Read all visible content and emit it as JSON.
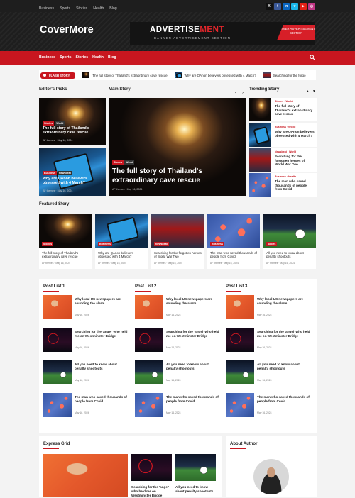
{
  "topbar": {
    "links": [
      "Business",
      "Sports",
      "Stories",
      "Health",
      "Blog"
    ],
    "social": [
      {
        "icon": "x-icon",
        "glyph": "X",
        "color": "#111111"
      },
      {
        "icon": "facebook-icon",
        "glyph": "f",
        "color": "#3b5998"
      },
      {
        "icon": "linkedin-icon",
        "glyph": "in",
        "color": "#0a66c2"
      },
      {
        "icon": "vimeo-icon",
        "glyph": "v",
        "color": "#1ab7ea"
      },
      {
        "icon": "youtube-icon",
        "glyph": "▶",
        "color": "#e62117"
      },
      {
        "icon": "instagram-icon",
        "glyph": "◎",
        "color": "#c13584"
      }
    ]
  },
  "site": {
    "logo": "CoverMore"
  },
  "ad": {
    "word1": "ADVERTISE",
    "word2": "MENT",
    "sub": "BANNER ADVERTISEMENT SECTION",
    "tag": "BANNER ADVERTISEMENT SECTION"
  },
  "nav": {
    "items": [
      "Business",
      "Sports",
      "Stories",
      "Health",
      "Blog"
    ]
  },
  "flash": {
    "label": "FLASH STORY",
    "items": [
      "The full story of Thailand's extraordinary cave rescue",
      "Why are QAnon believers obsessed with 4 March?",
      "Searching for the forgo"
    ]
  },
  "sections": {
    "editors": "Editor's Picks",
    "main": "Main Story",
    "trending": "Trending Story",
    "featured": "Featured Story",
    "pl1": "Post List 1",
    "pl2": "Post List 2",
    "pl3": "Post List 3",
    "express": "Express Grid",
    "about": "About Author"
  },
  "editors": [
    {
      "tags": [
        "Stories",
        "World"
      ],
      "title": "The full story of Thailand's extraordinary cave rescue",
      "author": "AF themes",
      "date": "May 16, 2024"
    },
    {
      "tags": [
        "Business",
        "Newsbeat"
      ],
      "title": "Why are QAnon believers obsessed with 4 March?",
      "author": "AF themes",
      "date": "May 16, 2024"
    }
  ],
  "main": {
    "tags": [
      "Stories",
      "World"
    ],
    "title": "The full story of Thailand's extraordinary cave rescue",
    "author": "AF themes",
    "date": "May 16, 2024"
  },
  "trending": [
    {
      "cat": "Stories · World",
      "title": "The full story of Thailand's extraordinary cave rescue"
    },
    {
      "cat": "Business · World",
      "title": "Why are QAnon believers obsessed with 4 March?"
    },
    {
      "cat": "Newsbeat · World",
      "title": "Searching for the forgotten heroes of World War Two"
    },
    {
      "cat": "Business · Health",
      "title": "The man who saved thousands of people from Covid"
    }
  ],
  "featured": [
    {
      "tag": "Stories",
      "title": "The full story of Thailand's extraordinary cave rescue",
      "author": "AF themes",
      "date": "May 16, 2024"
    },
    {
      "tag": "Business",
      "title": "Why are QAnon believers obsessed with 4 March?",
      "author": "AF themes",
      "date": "May 16, 2024"
    },
    {
      "tag": "Newsbeat",
      "title": "Searching for the forgotten heroes of World War Two",
      "author": "AF themes",
      "date": "May 16, 2024"
    },
    {
      "tag": "Business",
      "title": "The man who saved thousands of people from Covid",
      "author": "AF themes",
      "date": "May 16, 2024"
    },
    {
      "tag": "Sports",
      "title": "All you need to know about penalty shootouts",
      "author": "AF themes",
      "date": "May 16, 2024"
    }
  ],
  "postlist": [
    {
      "title": "Why local US newspapers are sounding the alarm",
      "date": "May 16, 2024"
    },
    {
      "title": "Searching for the 'angel' who held me on Westminster Bridge",
      "date": "May 16, 2024"
    },
    {
      "title": "All you need to know about penalty shootouts",
      "date": "May 16, 2024"
    },
    {
      "title": "The man who saved thousands of people from Covid",
      "date": "May 16, 2024"
    }
  ],
  "express": [
    {
      "title": "Searching for the 'angel' who held me on Westminster Bridge"
    },
    {
      "title": "All you need to know about penalty shootouts"
    }
  ]
}
